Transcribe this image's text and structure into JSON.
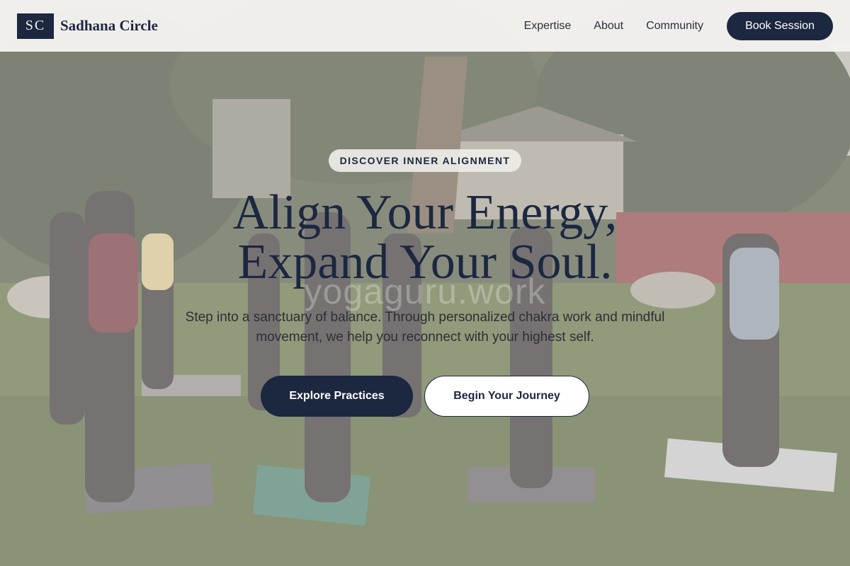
{
  "brand": {
    "logo_initials": "SC",
    "name": "Sadhana Circle"
  },
  "nav": {
    "links": [
      {
        "label": "Expertise"
      },
      {
        "label": "About"
      },
      {
        "label": "Community"
      }
    ],
    "cta_label": "Book Session"
  },
  "hero": {
    "eyebrow": "DISCOVER INNER ALIGNMENT",
    "headline_line1": "Align Your Energy,",
    "headline_line2": "Expand Your Soul.",
    "watermark": "yogaguru.work",
    "subtext": "Step into a sanctuary of balance. Through personalized chakra work and mindful movement, we help you reconnect with your highest self.",
    "primary_button": "Explore Practices",
    "secondary_button": "Begin Your Journey",
    "background_image": "outdoor-yoga-class-photo"
  },
  "colors": {
    "brand_navy": "#1c2740",
    "header_bg": "#f5f3f0",
    "text_dark": "#2c2f36",
    "button_light": "#ffffff"
  }
}
